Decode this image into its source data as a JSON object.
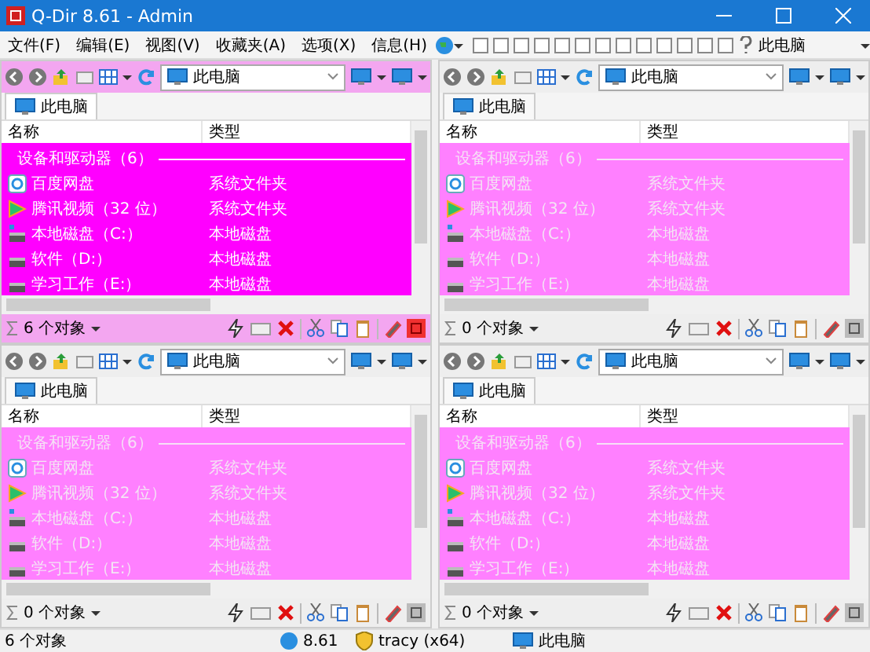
{
  "window": {
    "title": "Q-Dir 8.61 - Admin"
  },
  "menu": [
    "文件(F)",
    "编辑(E)",
    "视图(V)",
    "收藏夹(A)",
    "选项(X)",
    "信息(H)"
  ],
  "layout_toolbar": {
    "location": "此电脑"
  },
  "panes": [
    {
      "selected": true,
      "tab": "此电脑",
      "address": "此电脑",
      "columns": [
        "名称",
        "类型"
      ],
      "group": "设备和驱动器（6）",
      "count": "6 个对象",
      "rows": [
        {
          "kind": "cloud",
          "name": "百度网盘",
          "type": "系统文件夹"
        },
        {
          "kind": "video",
          "name": "腾讯视频（32 位）",
          "type": "系统文件夹"
        },
        {
          "kind": "system-drive",
          "name": "本地磁盘（C:）",
          "type": "本地磁盘"
        },
        {
          "kind": "drive",
          "name": "软件（D:）",
          "type": "本地磁盘"
        },
        {
          "kind": "drive",
          "name": "学习工作（E:）",
          "type": "本地磁盘"
        }
      ]
    },
    {
      "selected": false,
      "tab": "此电脑",
      "address": "此电脑",
      "columns": [
        "名称",
        "类型"
      ],
      "group": "设备和驱动器（6）",
      "count": "0 个对象",
      "rows": [
        {
          "kind": "cloud",
          "name": "百度网盘",
          "type": "系统文件夹"
        },
        {
          "kind": "video",
          "name": "腾讯视频（32 位）",
          "type": "系统文件夹"
        },
        {
          "kind": "system-drive",
          "name": "本地磁盘（C:）",
          "type": "本地磁盘"
        },
        {
          "kind": "drive",
          "name": "软件（D:）",
          "type": "本地磁盘"
        },
        {
          "kind": "drive",
          "name": "学习工作（E:）",
          "type": "本地磁盘"
        }
      ]
    },
    {
      "selected": false,
      "tab": "此电脑",
      "address": "此电脑",
      "columns": [
        "名称",
        "类型"
      ],
      "group": "设备和驱动器（6）",
      "count": "0 个对象",
      "rows": [
        {
          "kind": "cloud",
          "name": "百度网盘",
          "type": "系统文件夹"
        },
        {
          "kind": "video",
          "name": "腾讯视频（32 位）",
          "type": "系统文件夹"
        },
        {
          "kind": "system-drive",
          "name": "本地磁盘（C:）",
          "type": "本地磁盘"
        },
        {
          "kind": "drive",
          "name": "软件（D:）",
          "type": "本地磁盘"
        },
        {
          "kind": "drive",
          "name": "学习工作（E:）",
          "type": "本地磁盘"
        }
      ]
    },
    {
      "selected": false,
      "tab": "此电脑",
      "address": "此电脑",
      "columns": [
        "名称",
        "类型"
      ],
      "group": "设备和驱动器（6）",
      "count": "0 个对象",
      "rows": [
        {
          "kind": "cloud",
          "name": "百度网盘",
          "type": "系统文件夹"
        },
        {
          "kind": "video",
          "name": "腾讯视频（32 位）",
          "type": "系统文件夹"
        },
        {
          "kind": "system-drive",
          "name": "本地磁盘（C:）",
          "type": "本地磁盘"
        },
        {
          "kind": "drive",
          "name": "软件（D:）",
          "type": "本地磁盘"
        },
        {
          "kind": "drive",
          "name": "学习工作（E:）",
          "type": "本地磁盘"
        }
      ]
    }
  ],
  "status_bar": {
    "count": "6 个对象",
    "version": "8.61",
    "user": "tracy (x64)",
    "location": "此电脑"
  }
}
